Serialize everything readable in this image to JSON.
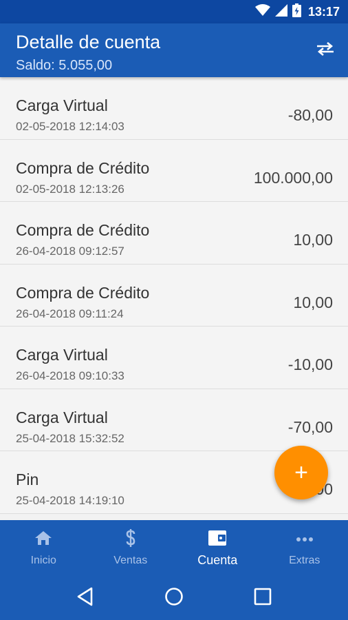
{
  "status_bar": {
    "time": "13:17"
  },
  "app_bar": {
    "title": "Detalle de cuenta",
    "subtitle": "Saldo: 5.055,00"
  },
  "transactions": [
    {
      "title": "Carga Virtual",
      "date": "02-05-2018 12:14:03",
      "amount": "-80,00"
    },
    {
      "title": "Compra de Crédito",
      "date": "02-05-2018 12:13:26",
      "amount": "100.000,00"
    },
    {
      "title": "Compra de Crédito",
      "date": "26-04-2018 09:12:57",
      "amount": "10,00"
    },
    {
      "title": "Compra de Crédito",
      "date": "26-04-2018 09:11:24",
      "amount": "10,00"
    },
    {
      "title": "Carga Virtual",
      "date": "26-04-2018 09:10:33",
      "amount": "-10,00"
    },
    {
      "title": "Carga Virtual",
      "date": "25-04-2018 15:32:52",
      "amount": "-70,00"
    },
    {
      "title": "Pin",
      "date": "25-04-2018 14:19:10",
      "amount": "-5,00"
    }
  ],
  "fab": {
    "label": "+"
  },
  "bottom_nav": {
    "items": [
      {
        "label": "Inicio",
        "icon": "home-icon"
      },
      {
        "label": "Ventas",
        "icon": "dollar-icon"
      },
      {
        "label": "Cuenta",
        "icon": "wallet-icon",
        "active": true
      },
      {
        "label": "Extras",
        "icon": "more-horizontal-icon"
      }
    ]
  },
  "colors": {
    "primary": "#1b5cb5",
    "status_bar": "#0d47a1",
    "accent": "#ff8f00",
    "background": "#f4f4f4"
  }
}
